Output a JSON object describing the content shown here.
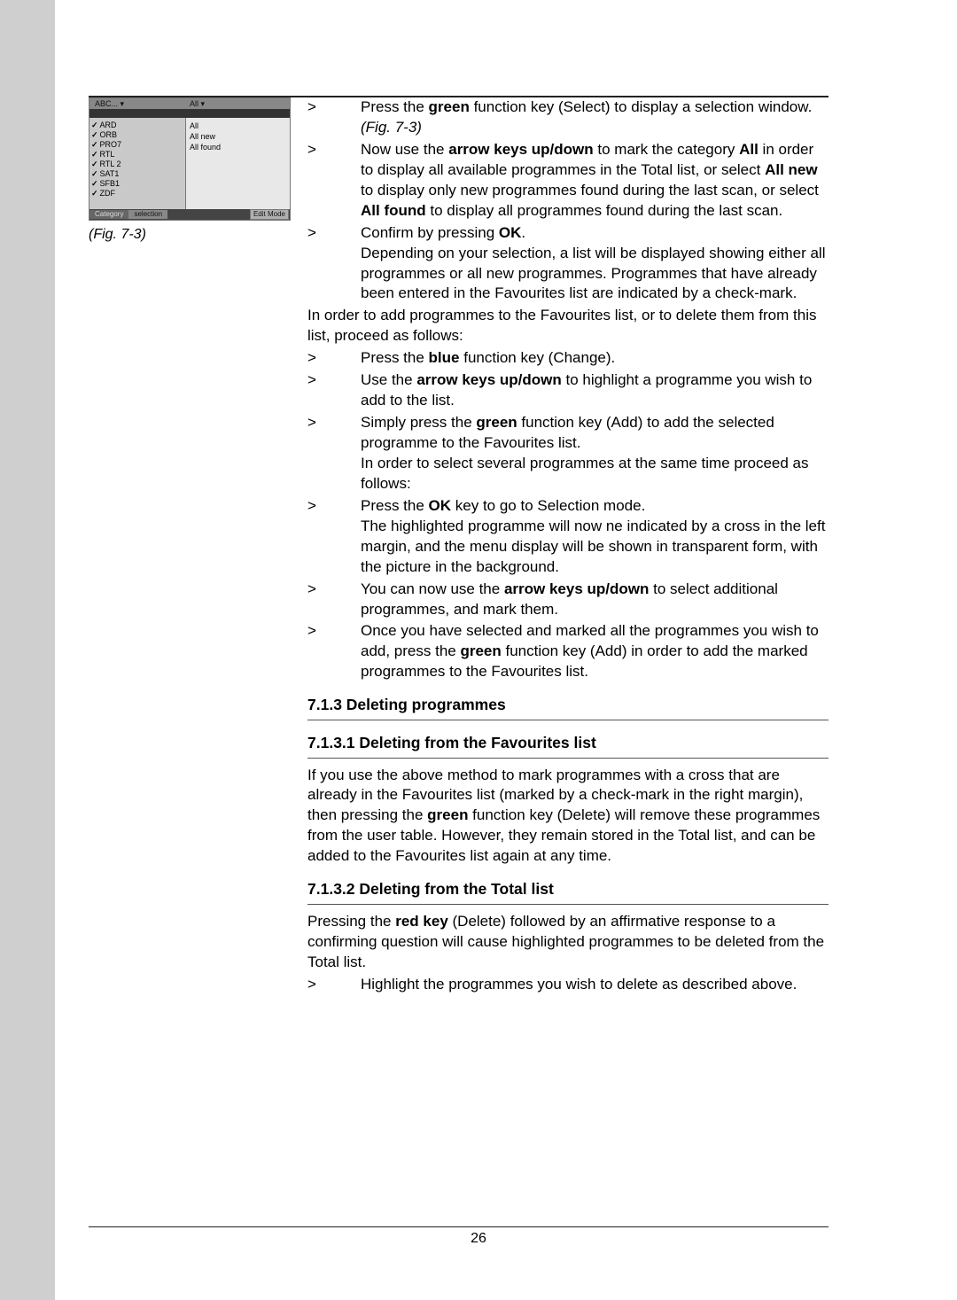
{
  "figure": {
    "header_left": "ABC... ▾",
    "header_right": "All ▾",
    "channels": [
      "ARD",
      "ORB",
      "PRO7",
      "RTL",
      "RTL 2",
      "SAT1",
      "SFB1",
      "ZDF"
    ],
    "options": [
      "All",
      "All new",
      "All found"
    ],
    "footer": {
      "category": "Category",
      "selection": "selection",
      "editmode": "Edit Mode"
    },
    "caption": "(Fig. 7-3)"
  },
  "gt": ">",
  "steps1": {
    "a1": "Press the ",
    "a2": "green",
    "a3": " function key (Select) to display a selection window. ",
    "a3i": "(Fig. 7-3)",
    "b1": "Now use the ",
    "b2": "arrow keys up/down",
    "b3": " to mark the category ",
    "b4": "All",
    "b5": " in order to display all available programmes in the Total list, or select ",
    "b6": "All new",
    "b7": "  to display only new programmes found during the last scan, or select ",
    "b8": "All found",
    "b9": " to display all programmes found during the last scan.",
    "c1": "Confirm by pressing ",
    "c2": "OK",
    "c3": ".",
    "c4": "Depending on your selection, a list will be displayed showing either all programmes or all new programmes. Programmes that have already been entered in the Favourites list are indicated by a check-mark."
  },
  "para1": "In order to add programmes to the Favourites list, or to delete them from this list, proceed as follows:",
  "steps2": {
    "a1": "Press the ",
    "a2": "blue",
    "a3": " function key (Change).",
    "b1": "Use the ",
    "b2": "arrow keys up/down",
    "b3": " to highlight a programme you wish to add to the list.",
    "c1": "Simply press the ",
    "c2": "green",
    "c3": " function key (Add) to add the selected programme to the Favourites list.",
    "c4": "In order to select several programmes at the same time proceed as follows:",
    "d1": "Press the ",
    "d2": "OK",
    "d3": " key to go to Selection mode.",
    "d4": "The highlighted programme will now ne indicated by a cross in the left margin, and the menu display will be shown in transparent form, with the picture in the background.",
    "e1": "You can now use the ",
    "e2": "arrow keys up/down",
    "e3": " to select additional programmes, and mark them.",
    "f1": "Once you have selected and marked all the programmes you wish to add, press the ",
    "f2": "green",
    "f3": " function key (Add) in order to add the marked programmes to the Favourites list."
  },
  "h1": "7.1.3 Deleting programmes",
  "h2": "7.1.3.1 Deleting from the Favourites list",
  "para2a": "If you use the above method to mark programmes with a cross that are already in the Favourites list (marked by a check-mark in the right margin), then pressing the ",
  "para2b": "green",
  "para2c": " function key (Delete) will remove these programmes from the user table. However, they remain stored in the Total list, and can be added to the Favourites list again at any time.",
  "h3": "7.1.3.2 Deleting from the Total list",
  "para3a": "Pressing the ",
  "para3b": "red key",
  "para3c": " (Delete) followed by an affirmative response to a confirming question will cause highlighted programmes to be deleted from the Total list.",
  "steps3": {
    "a": "Highlight the programmes you wish to delete as described above."
  },
  "pagenum": "26"
}
